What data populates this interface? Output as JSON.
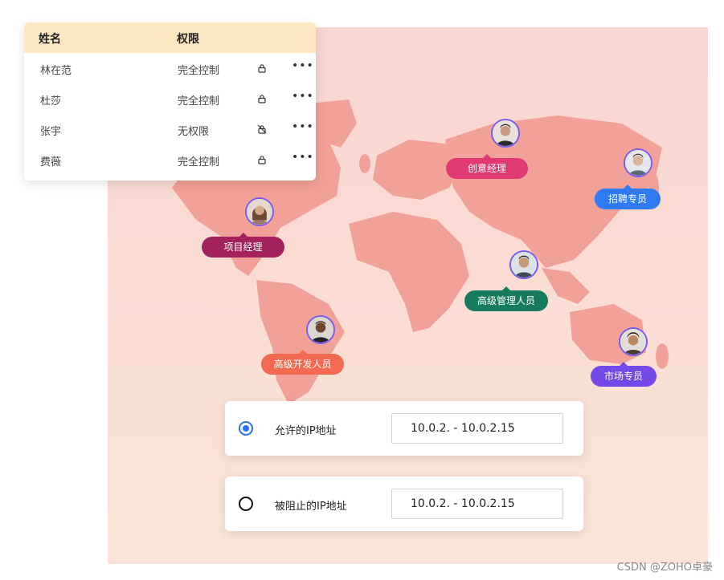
{
  "permissions": {
    "headers": {
      "name": "姓名",
      "permission": "权限"
    },
    "rows": [
      {
        "name": "林在范",
        "permission": "完全控制",
        "lock_icon": "lock-icon"
      },
      {
        "name": "杜莎",
        "permission": "完全控制",
        "lock_icon": "lock-icon"
      },
      {
        "name": "张宇",
        "permission": "无权限",
        "lock_icon": "lock-off-icon"
      },
      {
        "name": "费薇",
        "permission": "完全控制",
        "lock_icon": "lock-icon"
      }
    ],
    "more_label": "•••"
  },
  "map": {
    "people": [
      {
        "role": "创意经理",
        "color": "#e03a73"
      },
      {
        "role": "招聘专员",
        "color": "#2f7bf5"
      },
      {
        "role": "项目经理",
        "color": "#a3215c"
      },
      {
        "role": "高级管理人员",
        "color": "#167a5c"
      },
      {
        "role": "高级开发人员",
        "color": "#f26a4f"
      },
      {
        "role": "市场专员",
        "color": "#7449e8"
      }
    ]
  },
  "ip_filters": [
    {
      "label": "允许的IP地址",
      "value": "10.0.2. - 10.0.2.15",
      "selected": true,
      "accent": "#2f6ff5"
    },
    {
      "label": "被阻止的IP地址",
      "value": "10.0.2. - 10.0.2.15",
      "selected": false
    }
  ],
  "watermark": "CSDN @ZOHO卓豪"
}
